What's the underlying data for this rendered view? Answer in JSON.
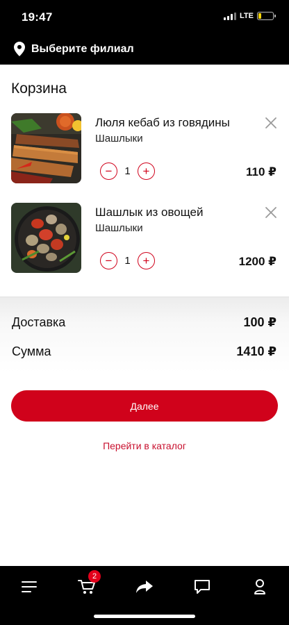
{
  "status_bar": {
    "time": "19:47",
    "network": "LTE",
    "battery_level": 0.2
  },
  "header": {
    "branch_label": "Выберите филиал",
    "icon": "location-pin-icon"
  },
  "cart": {
    "title": "Корзина",
    "items": [
      {
        "name": "Люля кебаб из говядины",
        "category": "Шашлыки",
        "quantity": "1",
        "price": "110 ₽",
        "minus": "−",
        "plus": "+",
        "image": "lula-kebab-photo"
      },
      {
        "name": "Шашлык из овощей",
        "category": "Шашлыки",
        "quantity": "1",
        "price": "1200 ₽",
        "minus": "−",
        "plus": "+",
        "image": "vegetable-shashlik-photo"
      }
    ]
  },
  "totals": {
    "delivery_label": "Доставка",
    "delivery_value": "100 ₽",
    "sum_label": "Сумма",
    "sum_value": "1410 ₽"
  },
  "actions": {
    "next_label": "Далее",
    "catalog_link": "Перейти в каталог"
  },
  "tabbar": {
    "items": [
      "menu-icon",
      "cart-icon",
      "share-icon",
      "chat-icon",
      "profile-icon"
    ],
    "cart_badge": "2"
  },
  "colors": {
    "accent": "#d0021b",
    "bar_background": "#000000"
  }
}
